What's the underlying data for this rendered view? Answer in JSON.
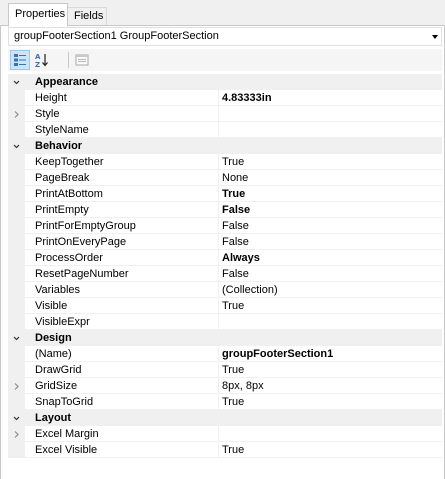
{
  "tabs": [
    {
      "label": "Properties",
      "active": true
    },
    {
      "label": "Fields",
      "active": false
    }
  ],
  "object_selector": {
    "value": "groupFooterSection1 GroupFooterSection"
  },
  "toolbar": {
    "categorized_icon": "categorized-view-icon",
    "alphabetical_icon": "alphabetical-sort-icon",
    "property_pages_icon": "property-pages-icon"
  },
  "categories": [
    {
      "name": "Appearance",
      "properties": [
        {
          "name": "Height",
          "value": "4.83333in",
          "bold": true,
          "expandable": false
        },
        {
          "name": "Style",
          "value": "",
          "bold": false,
          "expandable": true
        },
        {
          "name": "StyleName",
          "value": "",
          "bold": false,
          "expandable": false
        }
      ]
    },
    {
      "name": "Behavior",
      "properties": [
        {
          "name": "KeepTogether",
          "value": "True",
          "bold": false,
          "expandable": false
        },
        {
          "name": "PageBreak",
          "value": "None",
          "bold": false,
          "expandable": false
        },
        {
          "name": "PrintAtBottom",
          "value": "True",
          "bold": true,
          "expandable": false
        },
        {
          "name": "PrintEmpty",
          "value": "False",
          "bold": true,
          "expandable": false
        },
        {
          "name": "PrintForEmptyGroup",
          "value": "False",
          "bold": false,
          "expandable": false
        },
        {
          "name": "PrintOnEveryPage",
          "value": "False",
          "bold": false,
          "expandable": false
        },
        {
          "name": "ProcessOrder",
          "value": "Always",
          "bold": true,
          "expandable": false
        },
        {
          "name": "ResetPageNumber",
          "value": "False",
          "bold": false,
          "expandable": false
        },
        {
          "name": "Variables",
          "value": "(Collection)",
          "bold": false,
          "expandable": false
        },
        {
          "name": "Visible",
          "value": "True",
          "bold": false,
          "expandable": false
        },
        {
          "name": "VisibleExpr",
          "value": "",
          "bold": false,
          "expandable": false
        }
      ]
    },
    {
      "name": "Design",
      "properties": [
        {
          "name": "(Name)",
          "value": "groupFooterSection1",
          "bold": true,
          "expandable": false
        },
        {
          "name": "DrawGrid",
          "value": "True",
          "bold": false,
          "expandable": false
        },
        {
          "name": "GridSize",
          "value": "8px, 8px",
          "bold": false,
          "expandable": true
        },
        {
          "name": "SnapToGrid",
          "value": "True",
          "bold": false,
          "expandable": false
        }
      ]
    },
    {
      "name": "Layout",
      "properties": [
        {
          "name": "Excel Margin",
          "value": "",
          "bold": false,
          "expandable": true
        },
        {
          "name": "Excel Visible",
          "value": "True",
          "bold": false,
          "expandable": false
        }
      ]
    }
  ],
  "colors": {
    "category_bg": "#f0f0f0",
    "toolbar_pressed": "#cce4f7",
    "border": "#c8c8c8"
  }
}
